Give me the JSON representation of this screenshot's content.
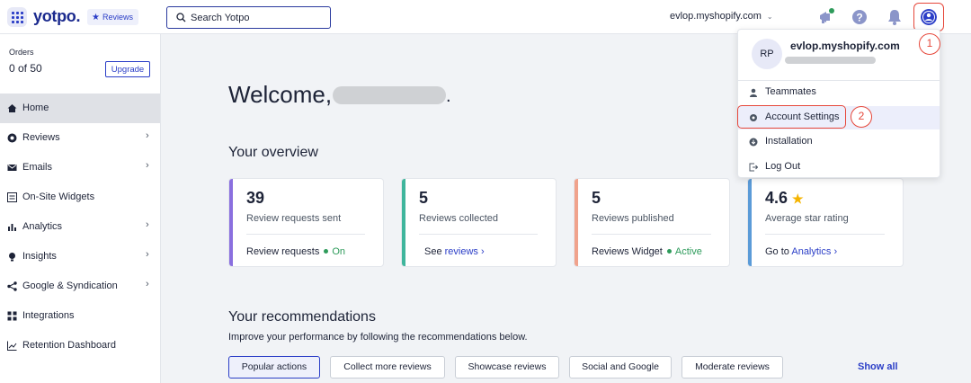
{
  "header": {
    "logo": "yotpo.",
    "product_tag": "Reviews",
    "search_placeholder": "Search Yotpo",
    "store_name": "evlop.myshopify.com"
  },
  "sidebar": {
    "orders_label": "Orders",
    "orders_value": "0 of 50",
    "upgrade_label": "Upgrade",
    "items": [
      {
        "label": "Home",
        "icon": "home-icon",
        "active": true,
        "has_arrow": false
      },
      {
        "label": "Reviews",
        "icon": "reviews-icon",
        "active": false,
        "has_arrow": true
      },
      {
        "label": "Emails",
        "icon": "email-icon",
        "active": false,
        "has_arrow": true
      },
      {
        "label": "On-Site Widgets",
        "icon": "widget-icon",
        "active": false,
        "has_arrow": false
      },
      {
        "label": "Analytics",
        "icon": "analytics-icon",
        "active": false,
        "has_arrow": true
      },
      {
        "label": "Insights",
        "icon": "insights-icon",
        "active": false,
        "has_arrow": true
      },
      {
        "label": "Google & Syndication",
        "icon": "share-icon",
        "active": false,
        "has_arrow": true
      },
      {
        "label": "Integrations",
        "icon": "integrations-icon",
        "active": false,
        "has_arrow": false
      },
      {
        "label": "Retention Dashboard",
        "icon": "retention-icon",
        "active": false,
        "has_arrow": false
      }
    ]
  },
  "main": {
    "welcome": "Welcome,",
    "overview_title": "Your overview",
    "cards": [
      {
        "value": "39",
        "desc": "Review requests sent",
        "foot": "Review requests",
        "status": "On",
        "color": "#8a6fdf"
      },
      {
        "value": "5",
        "desc": "Reviews collected",
        "foot_prefix": "See",
        "foot_link": "reviews",
        "color": "#3fb59c"
      },
      {
        "value": "5",
        "desc": "Reviews published",
        "foot": "Reviews Widget",
        "status": "Active",
        "color": "#f0a28c"
      },
      {
        "value": "4.6",
        "desc": "Average star rating",
        "foot_prefix": "Go to",
        "foot_link": "Analytics",
        "color": "#5b9bd8"
      }
    ],
    "recommendations_title": "Your recommendations",
    "recommendations_sub": "Improve your performance by following the recommendations below.",
    "tabs": [
      "Popular actions",
      "Collect more reviews",
      "Showcase reviews",
      "Social and Google",
      "Moderate reviews"
    ],
    "show_all": "Show all"
  },
  "account_menu": {
    "initials": "RP",
    "store": "evlop.myshopify.com",
    "items": [
      {
        "label": "Teammates",
        "icon": "person-icon"
      },
      {
        "label": "Account Settings",
        "icon": "gear-icon"
      },
      {
        "label": "Installation",
        "icon": "install-icon"
      },
      {
        "label": "Log Out",
        "icon": "logout-icon"
      }
    ]
  },
  "callouts": [
    "1",
    "2"
  ],
  "colors": {
    "accent": "#2b3ec7",
    "annotation": "#e6473a",
    "success": "#2e9b5b"
  }
}
